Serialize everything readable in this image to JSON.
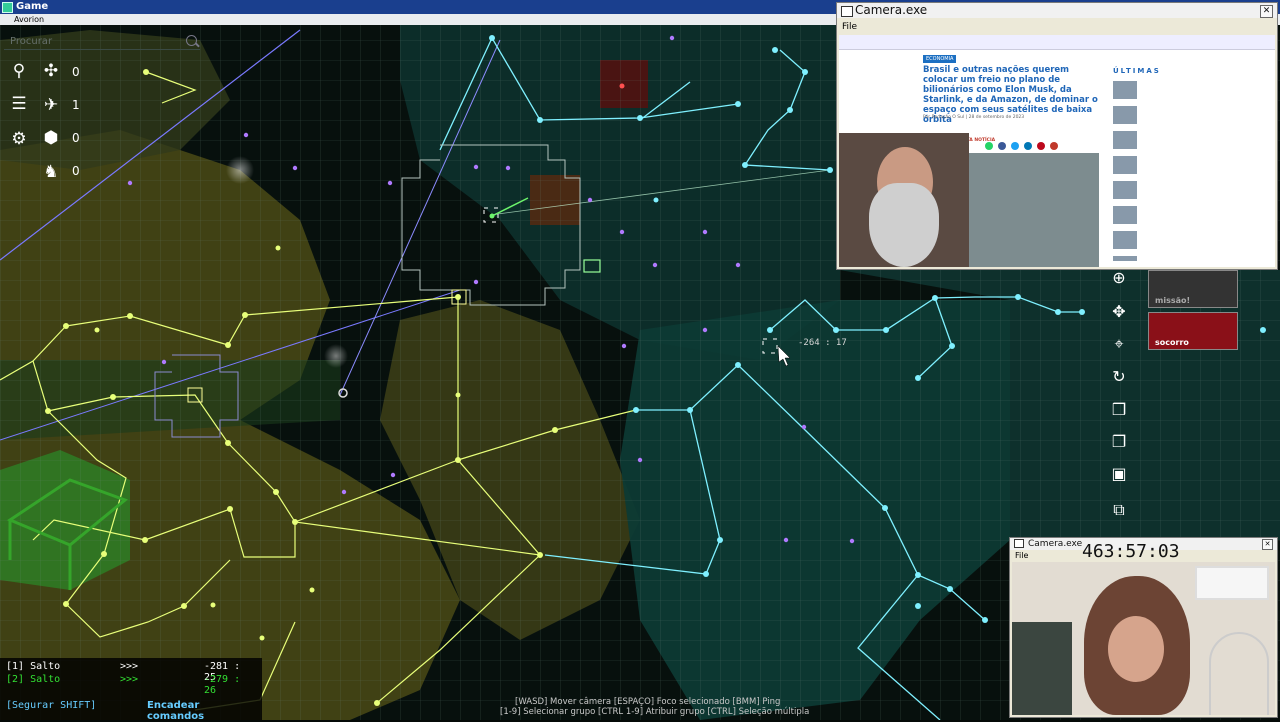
{
  "window": {
    "title": "Game",
    "subtitle": "Avorion"
  },
  "hud": {
    "search_placeholder": "Procurar",
    "counters": [
      {
        "icon": "drone-icon",
        "value": "0"
      },
      {
        "icon": "fighter-icon",
        "value": "1"
      },
      {
        "icon": "cargo-icon",
        "value": "0"
      },
      {
        "icon": "crew-icon",
        "value": "0"
      }
    ],
    "cursor_coords": "-264 : 17"
  },
  "commands": [
    {
      "label": "[1] Salto",
      "arrows": ">>>",
      "coords": "-281 : 25",
      "color": "#ffffff"
    },
    {
      "label": "[2] Salto",
      "arrows": ">>>",
      "coords": "-279 : 26",
      "color": "#33e033"
    }
  ],
  "command_footer": {
    "shift": "[Segurar SHIFT]",
    "chain": "Encadear comandos"
  },
  "hints": {
    "line1": "[WASD] Mover câmera    [ESPAÇO] Foco selecionado    [BMM] Ping",
    "line2": "[1-9] Selecionar grupo    [CTRL 1-9] Atribuir grupo    [CTRL] Seleção múltipla"
  },
  "right_panel": {
    "mission": "missão!",
    "help": "socorro"
  },
  "camera_top": {
    "title": "Camera.exe",
    "menu": "File",
    "article_tag": "ECONOMIA",
    "headline": "Brasil e outras nações querem colocar um freio no plano de bilionários como Elon Musk, da Starlink, e da Amazon, de dominar o espaço com seus satélites de baixa órbita",
    "byline": "Por Redação O Sul | 28 de setembro de 2023",
    "share": "COMPARTILHE ESTA NOTÍCIA",
    "sidebar_title": "ÚLTIMAS"
  },
  "camera_bottom": {
    "title": "Camera.exe",
    "menu": "File",
    "timer": "463:57:03"
  },
  "colors": {
    "grid": "#6f8a7f",
    "cyan_route": "#7ff0ff",
    "yellow_route": "#e8ff7a",
    "titlebar": "#1a3f8e"
  }
}
